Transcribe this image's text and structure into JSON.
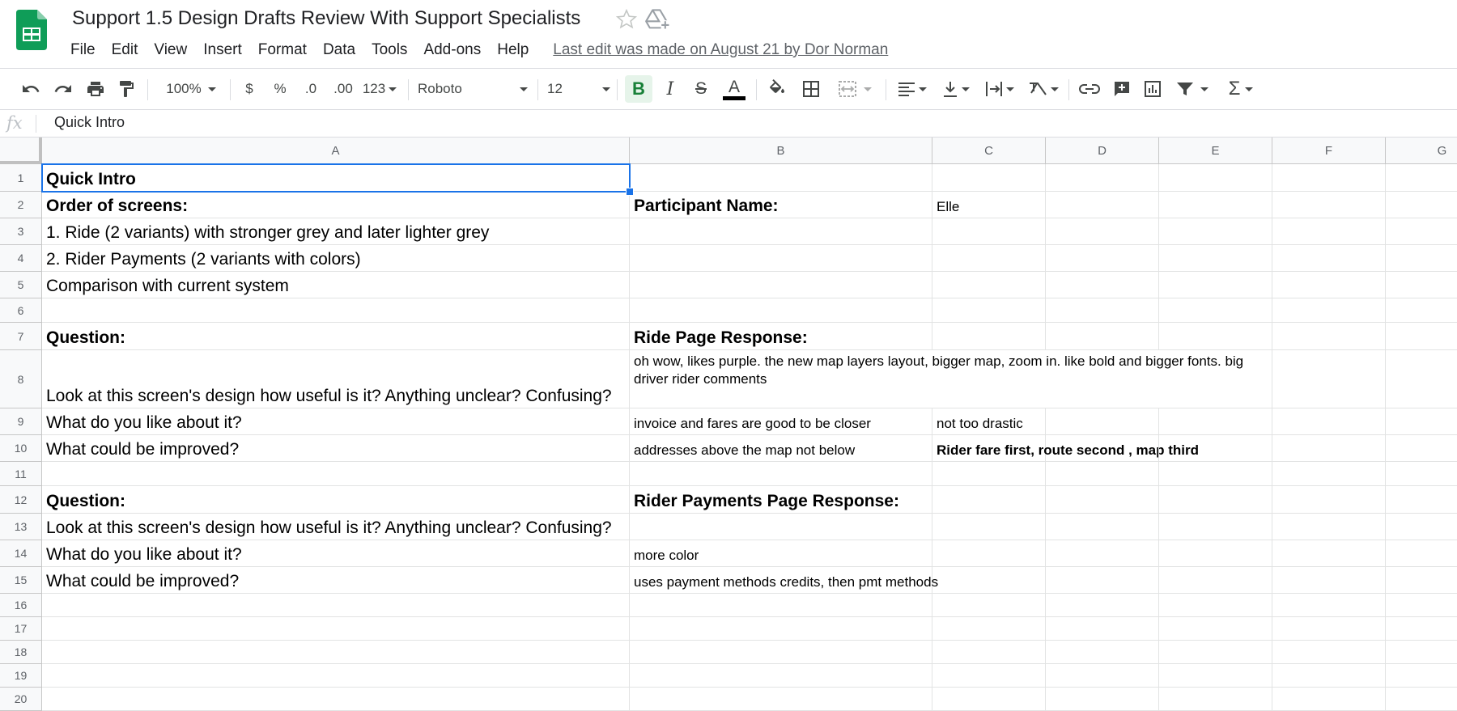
{
  "doc": {
    "title": "Support 1.5 Design Drafts Review With Support Specialists",
    "last_edit": "Last edit was made on August 21 by Dor Norman"
  },
  "menu": [
    "File",
    "Edit",
    "View",
    "Insert",
    "Format",
    "Data",
    "Tools",
    "Add-ons",
    "Help"
  ],
  "toolbar": {
    "zoom": "100%",
    "currency": "$",
    "percent": "%",
    "decrease_decimal": ".0",
    "increase_decimal": ".00",
    "more_formats": "123",
    "font": "Roboto",
    "font_size": "12",
    "bold": "B",
    "italic": "I",
    "strikethrough": "S",
    "text_color": "A"
  },
  "formula_bar": {
    "value": "Quick Intro"
  },
  "columns": [
    "A",
    "B",
    "C",
    "D",
    "E",
    "F",
    "G"
  ],
  "rows": [
    "1",
    "2",
    "3",
    "4",
    "5",
    "6",
    "7",
    "8",
    "9",
    "10",
    "11",
    "12",
    "13",
    "14",
    "15",
    "16",
    "17",
    "18",
    "19",
    "20"
  ],
  "cells": {
    "A1": "Quick Intro",
    "A2": "Order of screens:",
    "B2": "Participant Name:",
    "C2": "Elle",
    "A3": "1. Ride (2 variants) with stronger grey and later lighter grey",
    "A4": "2. Rider Payments (2 variants with colors)",
    "A5": "Comparison with current system",
    "A7": "Question:",
    "B7": "Ride Page Response:",
    "A8": "Look at this screen's design how useful is it? Anything unclear? Confusing?",
    "B8": "oh wow, likes purple. the new map layers layout, bigger map, zoom in. like bold and bigger fonts. big driver rider comments",
    "A9": "What do you like about it?",
    "B9": "invoice and fares are good to be closer",
    "C9": "not too drastic",
    "A10": "What could be improved?",
    "B10": "addresses above the map not below",
    "C10": "Rider fare first, route second , map third",
    "A12": "Question:",
    "B12": "Rider Payments Page Response:",
    "A13": "Look at this screen's design how useful is it? Anything unclear? Confusing?",
    "A14": "What do you like about it?",
    "B14": "more color",
    "A15": "What could be improved?",
    "B15": "uses payment methods credits, then pmt methods"
  },
  "colors": {
    "accent": "#1a73e8",
    "sheets_green": "#0f9d58",
    "bold_active": "#188038"
  }
}
